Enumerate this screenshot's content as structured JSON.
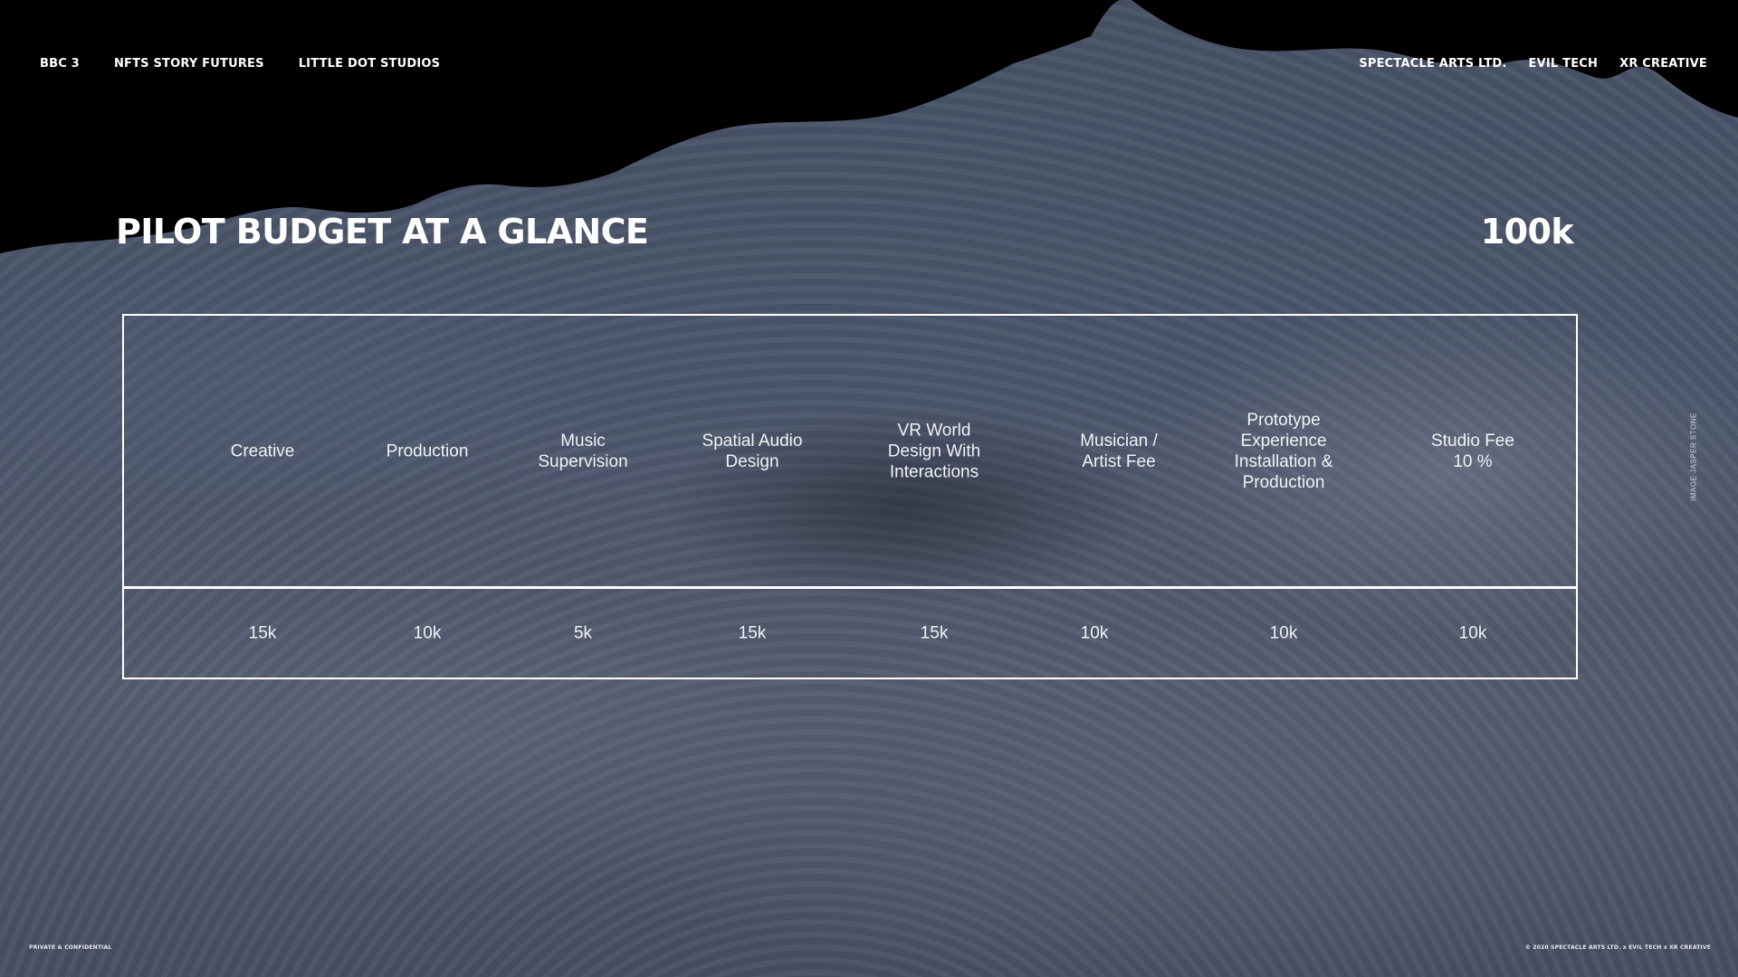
{
  "nav": {
    "left": [
      "BBC 3",
      "NFTS STORY FUTURES",
      "LITTLE DOT STUDIOS"
    ],
    "right": [
      "SPECTACLE ARTS  LTD.",
      "EVIL TECH",
      "XR CREATIVE"
    ]
  },
  "title": "PILOT BUDGET AT A GLANCE",
  "total": "100k",
  "table": {
    "headers": [
      "Creative",
      "Production",
      "Music\nSupervision",
      "Spatial Audio\nDesign",
      "VR World\nDesign With\nInteractions",
      "Musician /\nArtist Fee",
      "Prototype\nExperience\nInstallation &\nProduction",
      "Studio Fee\n10 %"
    ],
    "values": [
      "15k",
      "10k",
      "5k",
      "15k",
      "15k",
      "10k",
      "10k",
      "10k"
    ]
  },
  "image_credit": "IMAGE   JASPER STONE",
  "footer": {
    "left": "PRIVATE & CONFIDENTIAL",
    "right": "© 2020  SPECTACLE ARTS LTD. x EVIL TECH  x XR CREATIVE"
  },
  "colors": {
    "text": "#ffffff",
    "sky": "#000000",
    "water": "#4c566b"
  }
}
